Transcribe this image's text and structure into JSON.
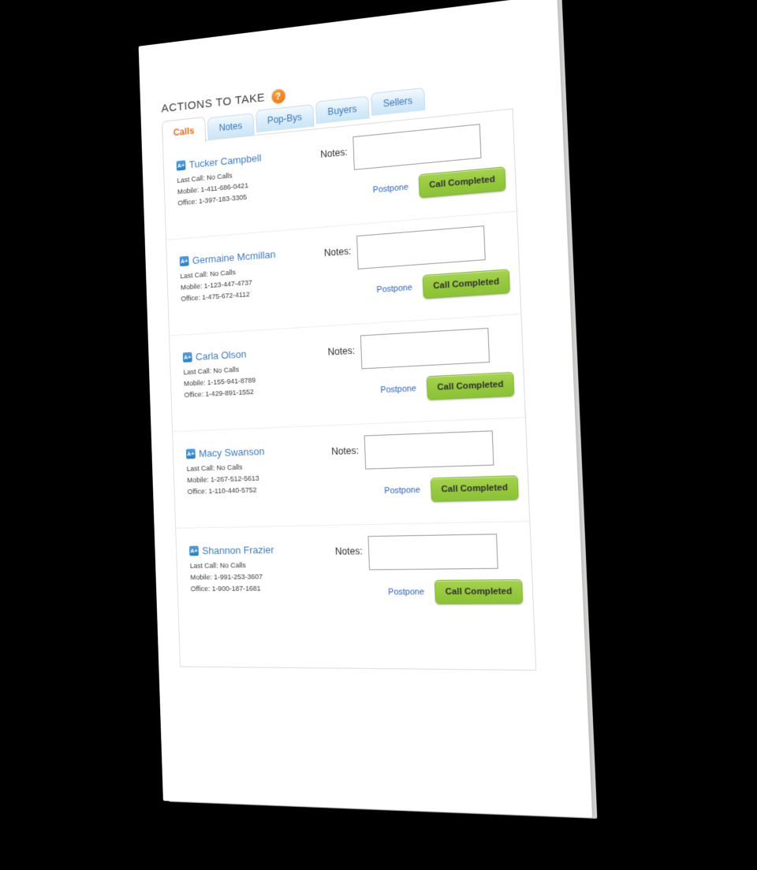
{
  "header": {
    "title": "ACTIONS TO TAKE",
    "help_icon": "help-question-icon",
    "help_label": "?"
  },
  "tabs": [
    {
      "label": "Calls",
      "active": true
    },
    {
      "label": "Notes",
      "active": false
    },
    {
      "label": "Pop-Bys",
      "active": false
    },
    {
      "label": "Buyers",
      "active": false
    },
    {
      "label": "Sellers",
      "active": false
    }
  ],
  "labels": {
    "notes": "Notes:",
    "postpone": "Postpone",
    "call_completed": "Call Completed",
    "last_call_prefix": "Last Call:",
    "mobile_prefix": "Mobile:",
    "office_prefix": "Office:",
    "grade_badge": "A+",
    "notes_placeholder": ""
  },
  "colors": {
    "accent_orange": "#f26c21",
    "link_blue": "#3a7bc8",
    "postpone_blue": "#2b5fc7",
    "button_green": "#95c93d",
    "tab_blue_bg": "#dceefa",
    "background": "#000000",
    "paper": "#ffffff"
  },
  "rows": [
    {
      "name": "Tucker Campbell",
      "badge": "A+",
      "last_call": "Last Call: No Calls",
      "mobile": "Mobile: 1-411-686-0421",
      "office": "Office: 1-397-183-3305",
      "notes_value": ""
    },
    {
      "name": "Germaine Mcmillan",
      "badge": "A+",
      "last_call": "Last Call: No Calls",
      "mobile": "Mobile: 1-123-447-4737",
      "office": "Office: 1-475-672-4112",
      "notes_value": ""
    },
    {
      "name": "Carla Olson",
      "badge": "A+",
      "last_call": "Last Call: No Calls",
      "mobile": "Mobile: 1-155-941-8789",
      "office": "Office: 1-429-891-1552",
      "notes_value": ""
    },
    {
      "name": "Macy Swanson",
      "badge": "A+",
      "last_call": "Last Call: No Calls",
      "mobile": "Mobile: 1-267-512-5613",
      "office": "Office: 1-110-440-5752",
      "notes_value": ""
    },
    {
      "name": "Shannon Frazier",
      "badge": "A+",
      "last_call": "Last Call: No Calls",
      "mobile": "Mobile: 1-991-253-3607",
      "office": "Office: 1-900-187-1681",
      "notes_value": ""
    }
  ]
}
